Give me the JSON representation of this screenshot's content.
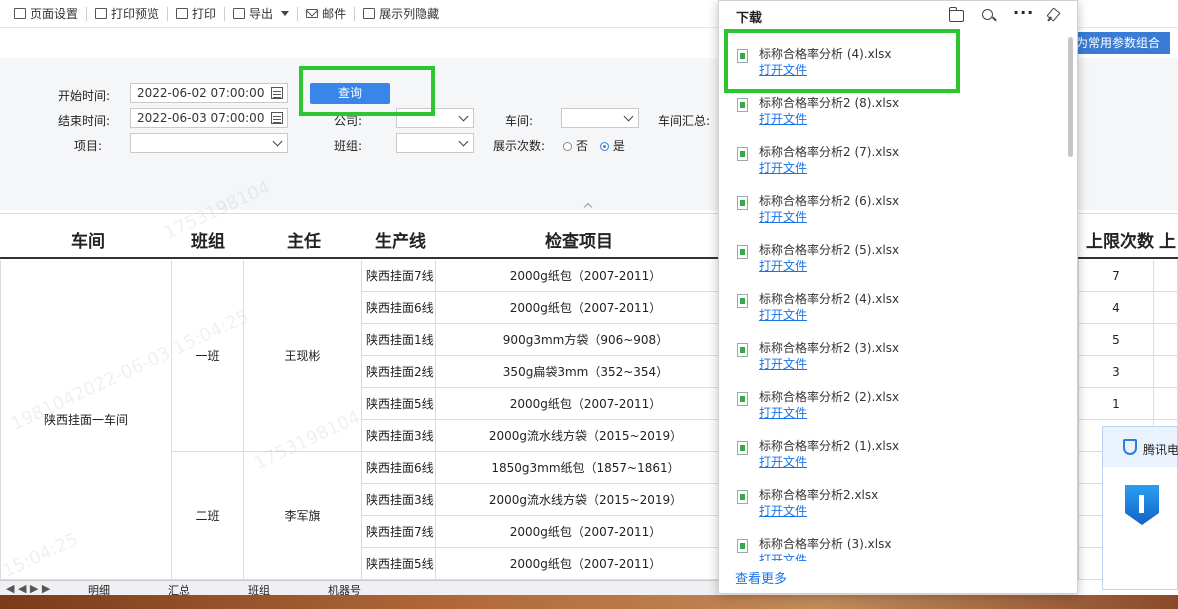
{
  "toolbar": {
    "items": [
      {
        "label": "页面设置",
        "icon": "page-setup-icon"
      },
      {
        "label": "打印预览",
        "icon": "print-preview-icon"
      },
      {
        "label": "打印",
        "icon": "printer-icon"
      },
      {
        "label": "导出",
        "icon": "export-icon"
      },
      {
        "label": "邮件",
        "icon": "mail-icon"
      },
      {
        "label": "展示列隐藏",
        "icon": "columns-icon"
      }
    ]
  },
  "common_params_button": "为常用参数组合",
  "filters": {
    "start_label": "开始时间:",
    "start_value": "2022-06-02 07:00:00",
    "end_label": "结束时间:",
    "end_value": "2022-06-03 07:00:00",
    "item_label": "项目:",
    "query_button": "查询",
    "company_label": "公司:",
    "team_label": "班组:",
    "workshop_label": "车间:",
    "show_count_label": "展示次数:",
    "show_count_no": "否",
    "show_count_yes": "是",
    "workshop_summary_label": "车间汇总:"
  },
  "table": {
    "headers": [
      "车间",
      "班组",
      "主任",
      "生产线",
      "检查项目",
      "上限次数",
      "上"
    ],
    "workshop": "陕西挂面一车间",
    "groups": [
      {
        "team": "一班",
        "director": "王现彬"
      },
      {
        "team": "二班",
        "director": "李军旗"
      }
    ],
    "rows": [
      {
        "line": "陕西挂面7线",
        "item": "2000g纸包（2007-2011）",
        "limit": "7"
      },
      {
        "line": "陕西挂面6线",
        "item": "2000g纸包（2007-2011）",
        "limit": "4"
      },
      {
        "line": "陕西挂面1线",
        "item": "900g3mm方袋（906~908）",
        "limit": "5"
      },
      {
        "line": "陕西挂面2线",
        "item": "350g扁袋3mm（352~354）",
        "limit": "3"
      },
      {
        "line": "陕西挂面5线",
        "item": "2000g纸包（2007-2011）",
        "limit": "1"
      },
      {
        "line": "陕西挂面3线",
        "item": "2000g流水线方袋（2015~2019）",
        "limit": ""
      },
      {
        "line": "陕西挂面6线",
        "item": "1850g3mm纸包（1857~1861）",
        "limit": ""
      },
      {
        "line": "陕西挂面3线",
        "item": "2000g流水线方袋（2015~2019）",
        "limit": ""
      },
      {
        "line": "陕西挂面7线",
        "item": "2000g纸包（2007-2011）",
        "limit": ""
      },
      {
        "line": "陕西挂面5线",
        "item": "2000g纸包（2007-2011）",
        "limit": ""
      }
    ]
  },
  "sheet_tabs": [
    "明细",
    "汇总",
    "班组",
    "机器号"
  ],
  "downloads": {
    "title": "下载",
    "open_label": "打开文件",
    "files": [
      "标称合格率分析 (4).xlsx",
      "标称合格率分析2 (8).xlsx",
      "标称合格率分析2 (7).xlsx",
      "标称合格率分析2 (6).xlsx",
      "标称合格率分析2 (5).xlsx",
      "标称合格率分析2 (4).xlsx",
      "标称合格率分析2 (3).xlsx",
      "标称合格率分析2 (2).xlsx",
      "标称合格率分析2 (1).xlsx",
      "标称合格率分析2.xlsx",
      "标称合格率分析 (3).xlsx"
    ],
    "see_more": "查看更多"
  },
  "notification": {
    "title": "腾讯电"
  },
  "colors": {
    "accent": "#3a86e8",
    "highlight": "#2ec62e",
    "link": "#1a73e8"
  }
}
